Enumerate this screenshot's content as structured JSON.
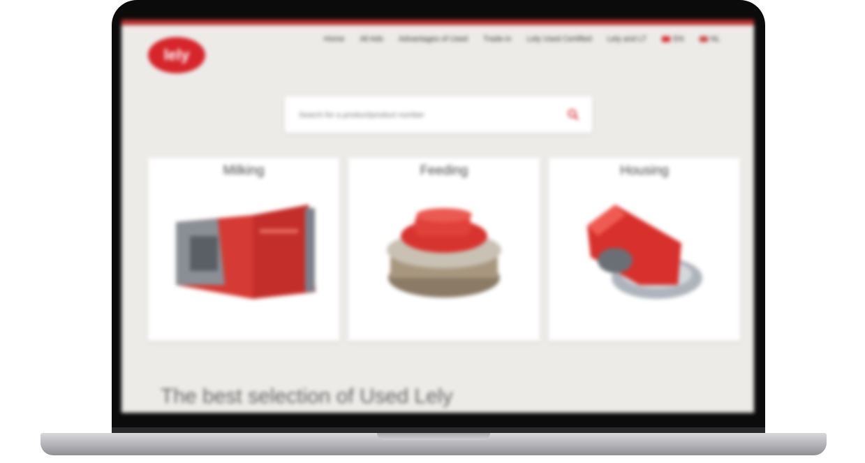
{
  "site": {
    "logo_text": "lely",
    "nav": [
      "Home",
      "All Ads",
      "Advantages of Used",
      "Trade-in",
      "Lely Used Certified",
      "Lely and LT"
    ],
    "languages": [
      "EN",
      "NL"
    ]
  },
  "search": {
    "placeholder": "Search for a product/product number"
  },
  "categories": [
    {
      "title": "Milking"
    },
    {
      "title": "Feeding"
    },
    {
      "title": "Housing"
    }
  ],
  "headline": "The best selection of Used Lely",
  "colors": {
    "brand_red": "#d6262b",
    "background": "#edebe8"
  }
}
